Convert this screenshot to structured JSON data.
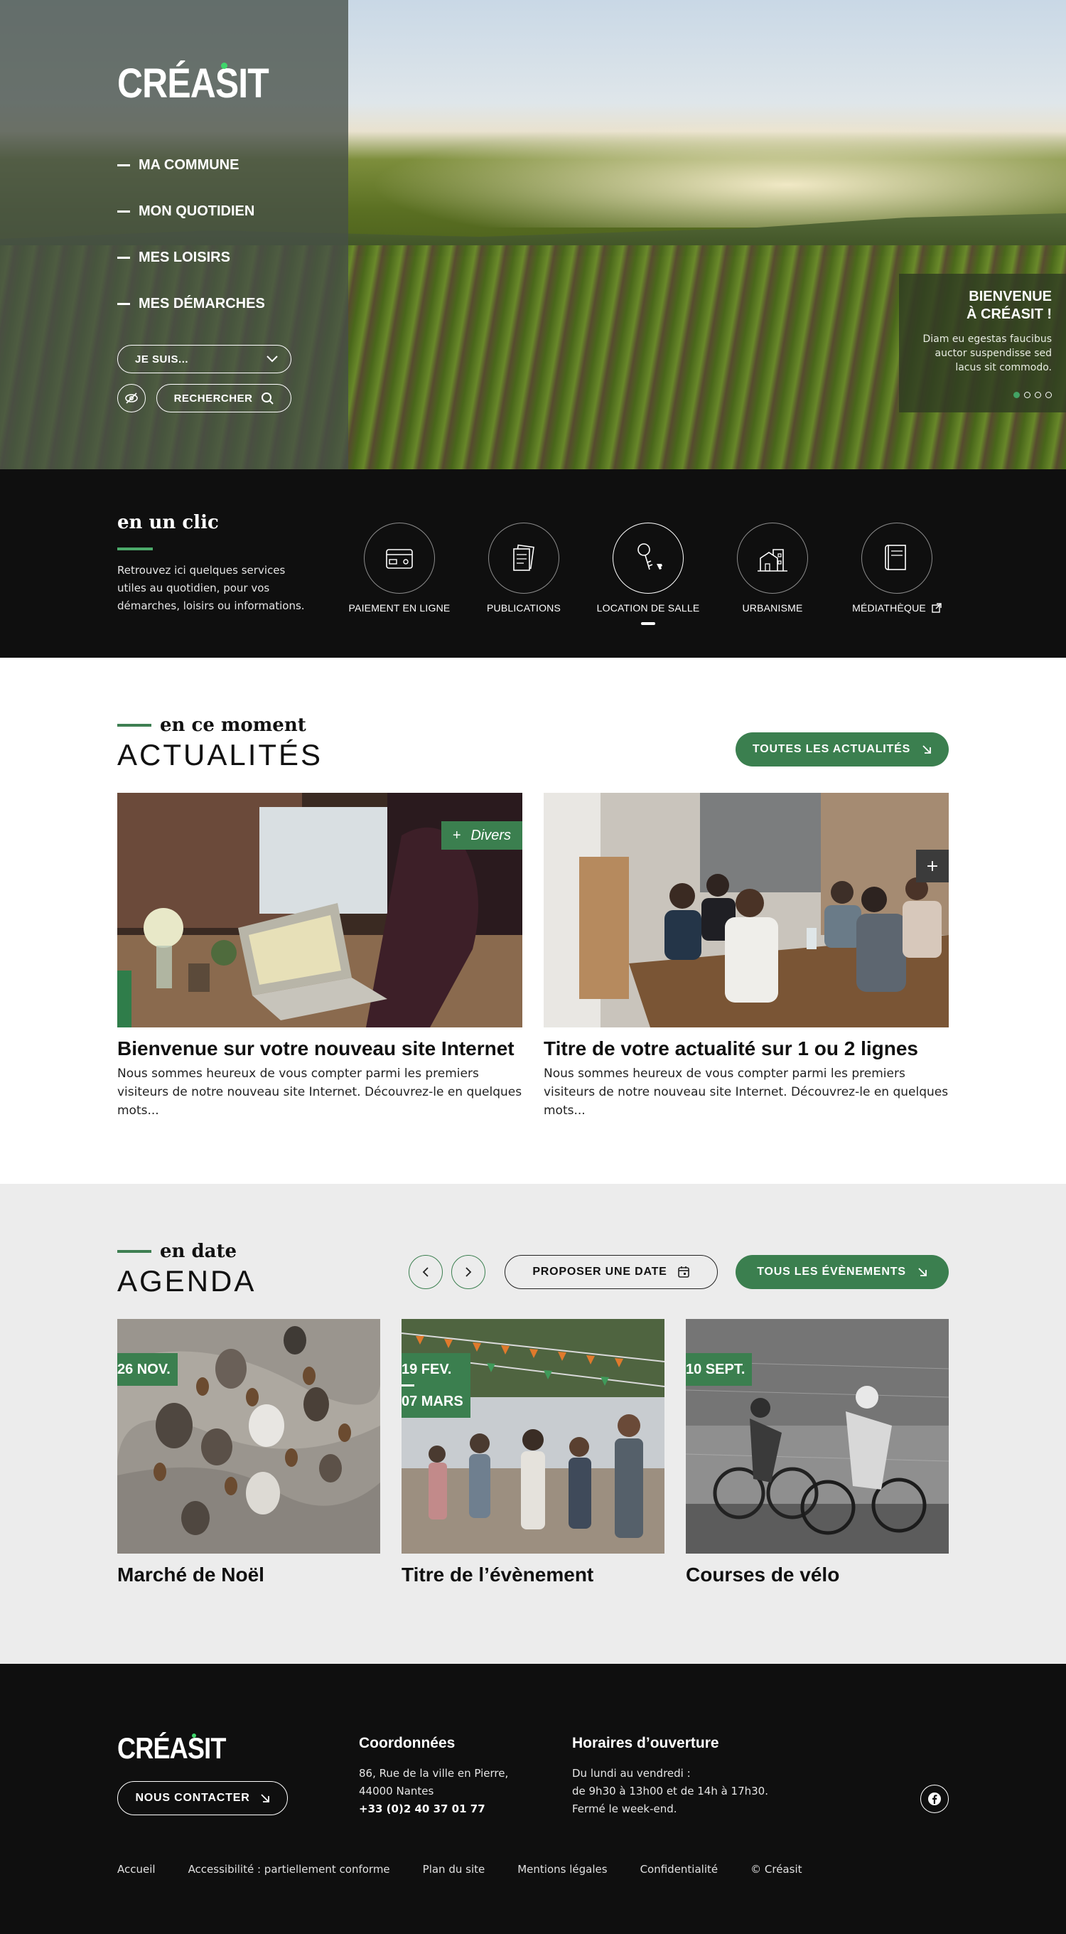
{
  "hero": {
    "logo": "CRÉASIT",
    "menu": [
      "MA COMMUNE",
      "MON QUOTIDIEN",
      "MES LOISIRS",
      "MES DÉMARCHES"
    ],
    "jesuis_label": "JE SUIS...",
    "search_label": "RECHERCHER",
    "welcome_title_1": "BIENVENUE",
    "welcome_title_2": "À CRÉASIT !",
    "welcome_text": "Diam eu egestas faucibus auctor suspendisse sed lacus sit commodo.",
    "slides_count": 4,
    "active_slide": 1
  },
  "quick": {
    "title": "en un clic",
    "description": "Retrouvez ici quelques services utiles au quotidien, pour vos démarches, loisirs ou informations.",
    "items": [
      {
        "label": "PAIEMENT EN LIGNE",
        "icon": "card-icon"
      },
      {
        "label": "PUBLICATIONS",
        "icon": "publications-icon"
      },
      {
        "label": "LOCATION DE SALLE",
        "icon": "keys-icon"
      },
      {
        "label": "URBANISME",
        "icon": "buildings-icon"
      },
      {
        "label": "MÉDIATHÈQUE",
        "icon": "book-icon"
      }
    ]
  },
  "news": {
    "kicker": "en ce moment",
    "title": "ACTUALITÉS",
    "all_button": "TOUTES LES ACTUALITÉS",
    "cards": [
      {
        "tag": "Divers",
        "title": "Bienvenue sur votre nouveau site Internet",
        "text": "Nous sommes heureux de vous compter parmi les premiers visiteurs de notre nouveau site Internet. Découvrez-le en quelques mots..."
      },
      {
        "tag": "+",
        "title": "Titre de votre actualité sur 1 ou 2 lignes",
        "text": "Nous sommes heureux de vous compter parmi les premiers visiteurs de notre nouveau site Internet. Découvrez-le en quelques mots..."
      }
    ]
  },
  "agenda": {
    "kicker": "en date",
    "title": "AGENDA",
    "propose_button": "PROPOSER UNE DATE",
    "all_button": "TOUS LES ÉVÈNEMENTS",
    "events": [
      {
        "date": "26 NOV.",
        "date_end": "",
        "title": "Marché de Noël"
      },
      {
        "date": "19 FEV.",
        "date_end": "07 MARS",
        "title": "Titre de l’évènement"
      },
      {
        "date": "10 SEPT.",
        "date_end": "",
        "title": "Courses de vélo"
      }
    ]
  },
  "footer": {
    "logo": "CRÉASIT",
    "contact_button": "NOUS CONTACTER",
    "coords_title": "Coordonnées",
    "address_1": "86, Rue de la ville en Pierre,",
    "address_2": "44000 Nantes",
    "phone": "+33 (0)2 40 37 01 77",
    "hours_title": "Horaires d’ouverture",
    "hours_1": "Du lundi au vendredi :",
    "hours_2": "de 9h30 à 13h00 et de 14h à 17h30.",
    "hours_3": "Fermé le week-end.",
    "links": [
      "Accueil",
      "Accessibilité : partiellement conforme",
      "Plan du site",
      "Mentions légales",
      "Confidentialité",
      "© Créasit"
    ]
  },
  "colors": {
    "brand_green": "#3b7f4f",
    "dark": "#0f0f0f",
    "light_bg": "#ececec"
  }
}
